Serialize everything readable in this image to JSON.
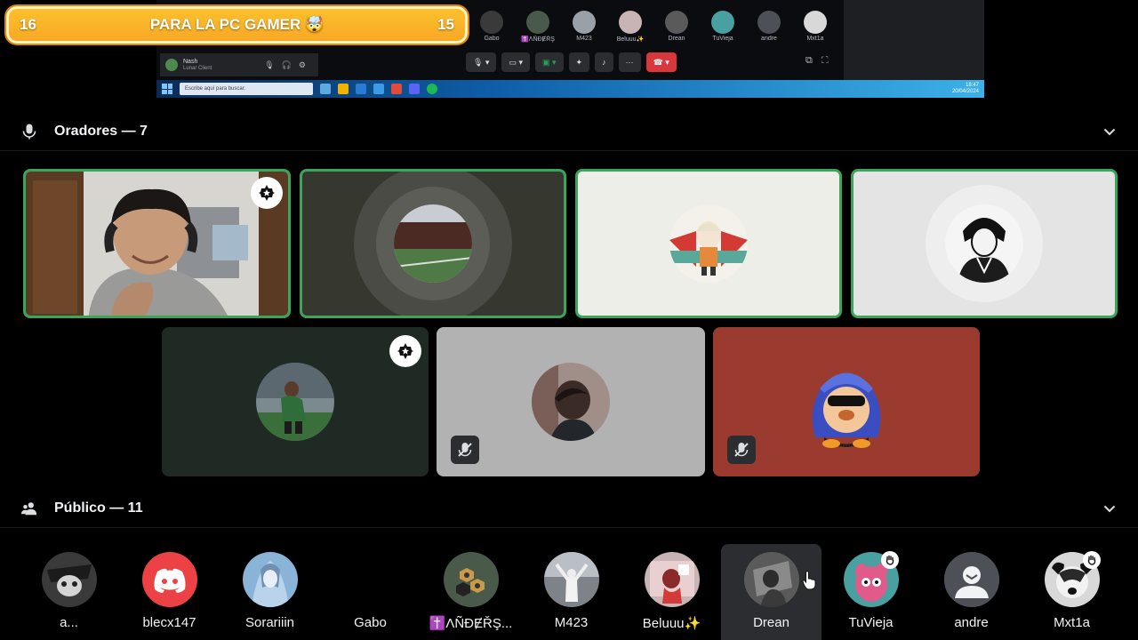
{
  "banner": {
    "left_number": "16",
    "title": "PARA LA PC GAMER 🤯",
    "right_number": "15"
  },
  "screen_share": {
    "participants": [
      "Gabo",
      "✝️ɅÑĐɆŘŞ",
      "M423",
      "Beluuu✨",
      "Drean",
      "TuVieja",
      "andre",
      "Mxt1a"
    ],
    "user_name": "Nash",
    "user_status": "Lunar Client",
    "taskbar_search": "Escribe aquí para buscar.",
    "clock_time": "18:47",
    "clock_date": "20/04/2024"
  },
  "speakers_section": {
    "label": "Oradores — 7",
    "icon": "microphone-icon"
  },
  "speakers": [
    {
      "id": "speaker-1",
      "bg": "#5a4a3c",
      "speaking": true,
      "moderator": true,
      "muted": false,
      "type": "camera"
    },
    {
      "id": "speaker-2",
      "bg": "#36372f",
      "speaking": true,
      "moderator": false,
      "muted": false,
      "type": "avatar"
    },
    {
      "id": "speaker-3",
      "bg": "#eeeee9",
      "speaking": true,
      "moderator": false,
      "muted": false,
      "type": "avatar"
    },
    {
      "id": "speaker-4",
      "bg": "#e4e4e4",
      "speaking": true,
      "moderator": false,
      "muted": false,
      "type": "avatar"
    },
    {
      "id": "speaker-5",
      "bg": "#1f2a24",
      "speaking": false,
      "moderator": true,
      "muted": false,
      "type": "avatar"
    },
    {
      "id": "speaker-6",
      "bg": "#b2b2b2",
      "speaking": false,
      "moderator": false,
      "muted": true,
      "type": "avatar"
    },
    {
      "id": "speaker-7",
      "bg": "#9b3a2e",
      "speaking": false,
      "moderator": false,
      "muted": true,
      "type": "avatar"
    }
  ],
  "audience_section": {
    "label": "Público — 11",
    "icon": "people-icon"
  },
  "audience": [
    {
      "name": "a...",
      "color": "#3a3a3a"
    },
    {
      "name": "blecx147",
      "color": "#ed4245"
    },
    {
      "name": "Sorariiin",
      "color": "#8ab3d8"
    },
    {
      "name": "Gabo",
      "color": ""
    },
    {
      "name": "✝️ɅÑĐɆŘŞ...",
      "color": "#4a5a4a"
    },
    {
      "name": "M423",
      "color": "#9aa0a8"
    },
    {
      "name": "Beluuu✨",
      "color": "#c8b4b4"
    },
    {
      "name": "Drean",
      "color": "#5a5a5a"
    },
    {
      "name": "TuVieja",
      "color": "#48a0a0"
    },
    {
      "name": "andre",
      "color": "#4e5058"
    },
    {
      "name": "Mxt1a",
      "color": "#d8d8d8"
    }
  ],
  "colors": {
    "speaking_border": "#3ba55c",
    "background": "#000000",
    "hover": "#2b2d31"
  }
}
